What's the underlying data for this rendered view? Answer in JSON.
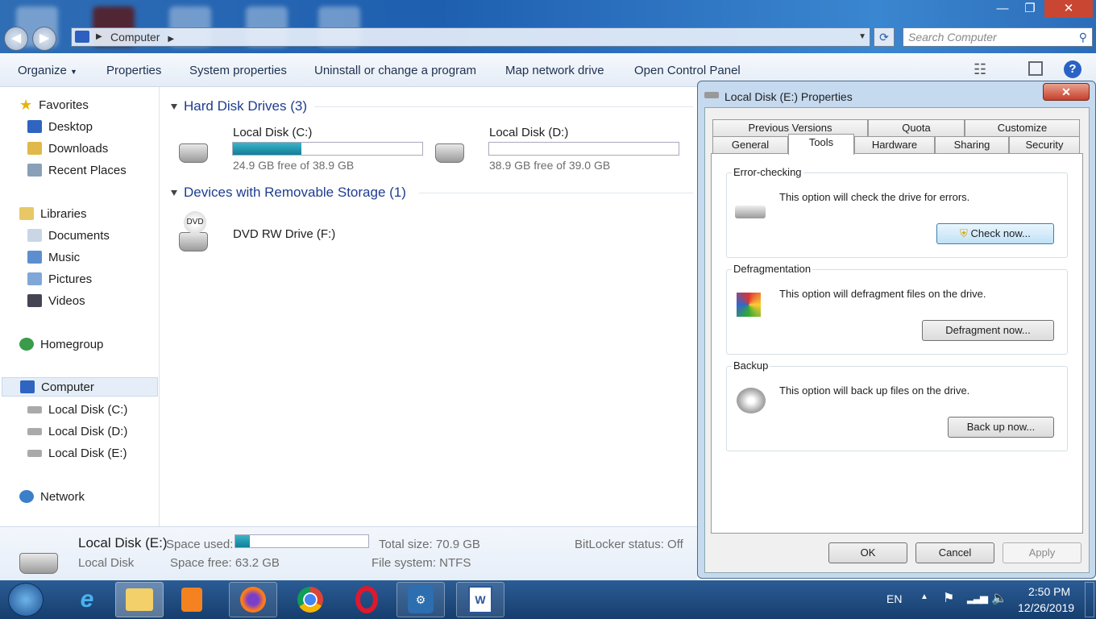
{
  "window": {
    "minimize": "—",
    "maximize": "❐",
    "close": "✕"
  },
  "address": {
    "path": "Computer",
    "search_placeholder": "Search Computer"
  },
  "toolbar": {
    "items": [
      "Organize",
      "Properties",
      "System properties",
      "Uninstall or change a program",
      "Map network drive",
      "Open Control Panel"
    ]
  },
  "sidebar": {
    "favorites": "Favorites",
    "fav_items": [
      "Desktop",
      "Downloads",
      "Recent Places"
    ],
    "libraries": "Libraries",
    "lib_items": [
      "Documents",
      "Music",
      "Pictures",
      "Videos"
    ],
    "homegroup": "Homegroup",
    "computer": "Computer",
    "comp_items": [
      "Local Disk (C:)",
      "Local Disk (D:)",
      "Local Disk (E:)"
    ],
    "network": "Network"
  },
  "content": {
    "hdd_header": "Hard Disk Drives (3)",
    "drives": [
      {
        "name": "Local Disk (C:)",
        "free": "24.9 GB free of 38.9 GB",
        "used_pct": 36
      },
      {
        "name": "Local Disk (D:)",
        "free": "38.9 GB free of 39.0 GB",
        "used_pct": 0
      }
    ],
    "removable_header": "Devices with Removable Storage (1)",
    "dvd": {
      "name": "DVD RW Drive (F:)",
      "badge": "DVD"
    }
  },
  "details": {
    "name": "Local Disk (E:)",
    "type": "Local Disk",
    "space_used_label": "Space used:",
    "used_pct": 11,
    "space_free": "Space free: 63.2 GB",
    "total": "Total size: 70.9 GB",
    "fs": "File system: NTFS",
    "bitlocker": "BitLocker status: Off"
  },
  "dialog": {
    "title": "Local Disk (E:) Properties",
    "close": "✕",
    "tabs_row1": [
      "Previous Versions",
      "Quota",
      "Customize"
    ],
    "tabs_row2": [
      "General",
      "Tools",
      "Hardware",
      "Sharing",
      "Security"
    ],
    "active_tab": "Tools",
    "groups": [
      {
        "legend": "Error-checking",
        "text": "This option will check the drive for errors.",
        "button": "Check now..."
      },
      {
        "legend": "Defragmentation",
        "text": "This option will defragment files on the drive.",
        "button": "Defragment now..."
      },
      {
        "legend": "Backup",
        "text": "This option will back up files on the drive.",
        "button": "Back up now..."
      }
    ],
    "ok": "OK",
    "cancel": "Cancel",
    "apply": "Apply"
  },
  "taskbar": {
    "lang": "EN",
    "time": "2:50 PM",
    "date": "12/26/2019"
  }
}
